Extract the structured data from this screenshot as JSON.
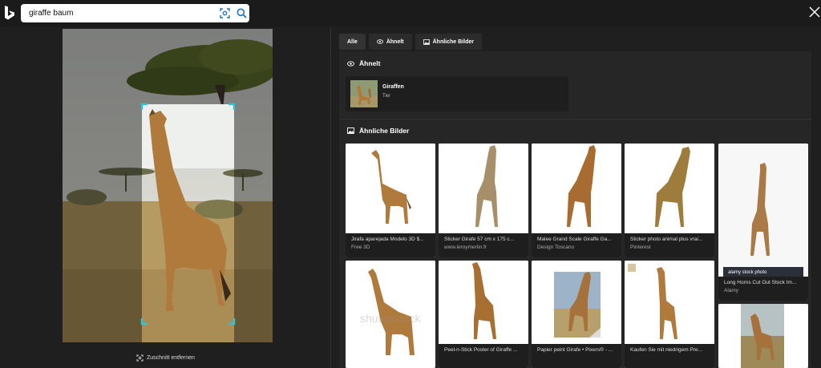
{
  "search": {
    "query": "giraffe baum"
  },
  "crop": {
    "label": "Zuschnitt entfernen"
  },
  "tabs": [
    {
      "label": "Alle"
    },
    {
      "label": "Ähnelt"
    },
    {
      "label": "Ähnliche Bilder"
    }
  ],
  "sections": {
    "similar_entity": "Ähnelt",
    "similar_images": "Ähnliche Bilder"
  },
  "entity": {
    "name": "Giraffen",
    "type": "Tier"
  },
  "results": [
    {
      "title": "Jirafa aparejada Modelo 3D $...",
      "source": "Free 3D"
    },
    {
      "title": "Sticker Girafe 57 cm x 175 c...",
      "source": "www.leroymerlin.fr"
    },
    {
      "title": "Malee Grand Scale Giraffe Ga...",
      "source": "Design Toscano"
    },
    {
      "title": "Sticker photo animal plus vrai...",
      "source": "Pinterest"
    },
    {
      "title": "Long Horns Cut Out Stock Im...",
      "source": "Alamy"
    },
    {
      "title": "",
      "source": ""
    },
    {
      "title": "Peel-n-Stick Poster of Giraffe ...",
      "source": ""
    },
    {
      "title": "Papier peint Girafe • Pixers® - ...",
      "source": ""
    },
    {
      "title": "Kaufen Sie mit niedrigem Pre...",
      "source": ""
    }
  ],
  "watermarks": {
    "alamy": "alamy stock photo",
    "shutterstock": "shutterstock"
  },
  "colors": {
    "background": "#1b1b1b",
    "panel": "#262626",
    "crop_handle": "#2ec4d6",
    "giraffe": "#b07a3c"
  }
}
